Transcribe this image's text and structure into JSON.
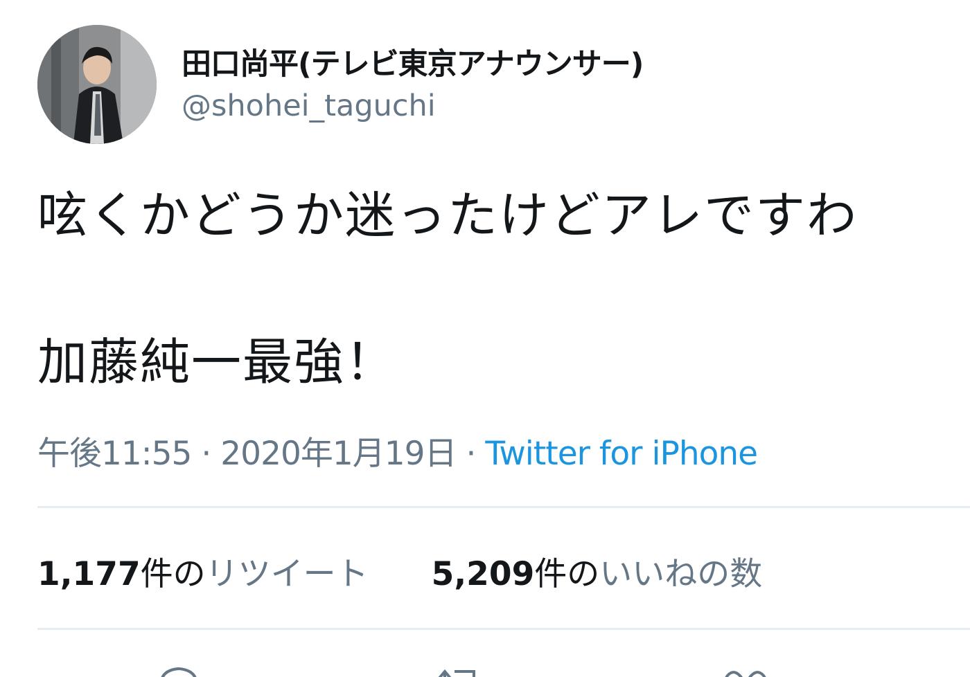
{
  "author": {
    "display_name": "田口尚平(テレビ東京アナウンサー)",
    "handle": "@shohei_taguchi",
    "avatar_icon": "profile-photo"
  },
  "tweet": {
    "text_line1": "呟くかどうか迷ったけどアレですわ",
    "text_line2": "加藤純一最強！"
  },
  "meta": {
    "timestamp": "午後11:55 · 2020年1月19日",
    "separator": " · ",
    "source": "Twitter for iPhone"
  },
  "stats": {
    "retweets": {
      "count": "1,177",
      "unit": "件の",
      "label": "リツイート"
    },
    "likes": {
      "count": "5,209",
      "unit": "件の",
      "label": "いいねの数"
    }
  },
  "actions": {
    "icons": [
      "reply-icon",
      "retweet-icon",
      "like-icon"
    ]
  },
  "colors": {
    "text": "#14171a",
    "secondary": "#657786",
    "link": "#1b95e0",
    "divider": "#e6ecf0"
  }
}
